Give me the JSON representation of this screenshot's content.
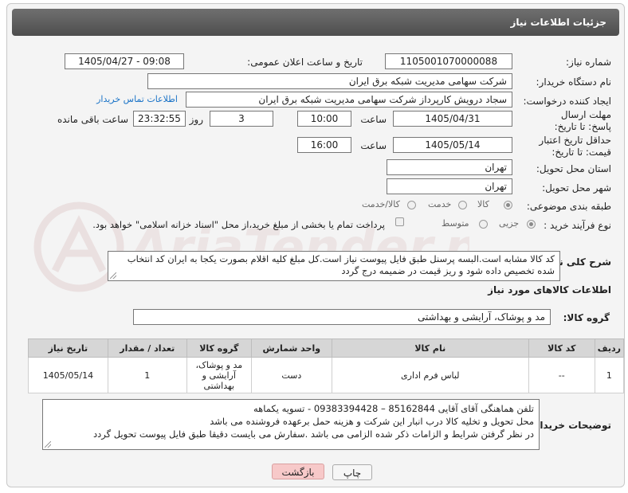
{
  "header": {
    "title": "جزئیات اطلاعات نیاز"
  },
  "fields": {
    "need_number_label": "شماره نیاز:",
    "need_number": "1105001070000088",
    "announce_label": "تاریخ و ساعت اعلان عمومی:",
    "announce_value": "1405/04/27 - 09:08",
    "buyer_org_label": "نام دستگاه خریدار:",
    "buyer_org": "شرکت سهامی مدیریت شبکه برق ایران",
    "creator_label": "ایجاد کننده درخواست:",
    "creator": "سجاد درویش کارپرداز شرکت سهامی مدیریت شبکه برق ایران",
    "buyer_contact_link": "اطلاعات تماس خریدار",
    "deadline_label": "مهلت ارسال پاسخ: تا تاریخ:",
    "deadline_date": "1405/04/31",
    "time_label": "ساعت",
    "deadline_time": "10:00",
    "days_value": "3",
    "days_and_label": "روز و",
    "remaining_time": "23:32:55",
    "remaining_label": "ساعت باقی مانده",
    "validity_label": "حداقل تاریخ اعتبار قیمت: تا تاریخ:",
    "validity_date": "1405/05/14",
    "validity_time": "16:00",
    "province_label": "استان محل تحویل:",
    "province": "تهران",
    "city_label": "شهر محل تحویل:",
    "city": "تهران",
    "category_label": "طبقه بندی موضوعی:",
    "category_options": [
      "کالا",
      "خدمت",
      "کالا/خدمت"
    ],
    "process_label": "نوع فرآیند خرید :",
    "process_options": [
      "جزیی",
      "متوسط"
    ],
    "payment_note": "پرداخت تمام یا بخشی از مبلغ خرید،از محل \"اسناد خزانه اسلامی\" خواهد بود."
  },
  "description": {
    "label": "شرح کلی نیاز:",
    "text": "کد کالا مشابه است.البسه پرسنل طبق فایل پیوست نیاز است.کل مبلغ کلیه اقلام بصورت یکجا به ایران کد انتخاب شده تخصیص داده شود و ریز قیمت در ضمیمه درج گردد"
  },
  "goods_section": {
    "title": "اطلاعات کالاهای مورد نیاز",
    "group_label": "گروه کالا:",
    "group_value": "مد و پوشاک، آرایشی و بهداشتی"
  },
  "table": {
    "headers": [
      "ردیف",
      "کد کالا",
      "نام کالا",
      "واحد شمارش",
      "گروه کالا",
      "تعداد / مقدار",
      "تاریخ نیاز"
    ],
    "rows": [
      [
        "1",
        "--",
        "لباس فرم اداری",
        "دست",
        "مد و پوشاک، آرایشی و بهداشتی",
        "1",
        "1405/05/14"
      ]
    ]
  },
  "buyer_notes": {
    "label": "توضیحات خریدار:",
    "lines": [
      "تلفن هماهنگی آقای آقایی 85162844 – 09383394428 - تسویه یکماهه",
      "محل تحویل و تخلیه کالا درب انبار این شرکت و هزینه حمل برعهده فروشنده می باشد",
      "در نظر گرفتن شرایط و الزامات ذکر شده الزامی می باشد .سفارش می بایست دقیقا طبق فایل پیوست تحویل گردد"
    ]
  },
  "buttons": {
    "print": "چاپ",
    "back": "بازگشت"
  },
  "colors": {
    "header": "#5a5a5a",
    "link": "#1a73c7",
    "back_button": "#f7c9c9"
  }
}
